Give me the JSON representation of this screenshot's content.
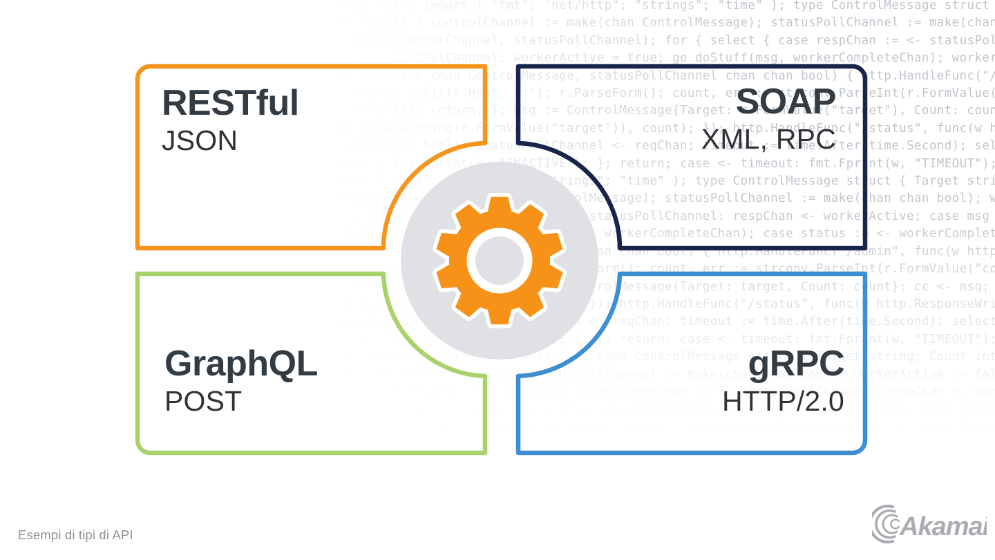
{
  "caption": "Esempi di tipi di API",
  "brand": {
    "logo_name": "akamai-logo",
    "logo_text": "Akamai",
    "logo_color": "#a9acb0"
  },
  "colors": {
    "restful_border": "#F7941E",
    "soap_border": "#17244C",
    "graphql_border": "#A9D26B",
    "grpc_border": "#3D8FD1",
    "gear_orange": "#F79219",
    "hub_disc": "#DFE1E5",
    "title_text": "#333b43",
    "subtitle_text": "#2f3237",
    "caption_text": "#8e9196",
    "code_text": "#9aa3ae",
    "background": "#ffffff"
  },
  "center": {
    "icon_name": "gear-icon",
    "teeth": 10
  },
  "quadrants": [
    {
      "id": "restful",
      "title": "RESTful",
      "subtitle": "JSON",
      "border_color": "#F7941E",
      "position": "top-left"
    },
    {
      "id": "soap",
      "title": "SOAP",
      "subtitle": "XML, RPC",
      "border_color": "#17244C",
      "position": "top-right"
    },
    {
      "id": "graphql",
      "title": "GraphQL",
      "subtitle": "POST",
      "border_color": "#A9D26B",
      "position": "bottom-left"
    },
    {
      "id": "grpc",
      "title": "gRPC",
      "subtitle": "HTTP/2.0",
      "border_color": "#3D8FD1",
      "position": "bottom-right"
    }
  ],
  "background_code": "ackage main; import ( \"fmt\"; \"net/http\"; \"strings\"; \"time\" ); type ControlMessage struct { Target string; Count int64; };\nfunc main() { controlChannel := make(chan ControlMessage); statusPollChannel := make(chan chan bool); workerActive := false;\ngo admin(controlChannel, statusPollChannel); for { select { case respChan := <- statusPollChannel: respChan <- workerActive; case\nmsg := <-controlChannel: workerActive = true; go doStuff(msg, workerCompleteChan); workerActive = status;\nfunc admin(cc chan ControlMessage, statusPollChannel chan chan bool) { http.HandleFunc(\"/admin\", func(w http.ResponseWriter, r *http.Request) { hostTokens\n:= strings.Split(r.Host, \":\"); r.ParseForm(); count, err := strconv.ParseInt(r.FormValue(\"count\"), 10, 64); if err != nil { fmt.Fprintf(w,\nerr.Error()); return; }; msg := ControlMessage{Target: r.FormValue(\"target\"), Count: count}; cc <- msg; fmt.Fprintf(w, \"Control message issued for Target %s, count %d\",\nhtml.EscapeString(r.FormValue(\"target\")), count); }); http.HandleFunc(\"/status\", func(w http.ResponseWriter, r *http.Request) { reqChan\n:= make(chan bool); statusPollChannel <- reqChan; timeout := time.After(time.Second); select { case result := <- reqChan: if result { fmt.Fprint(w, \"ACTIVE\");\n} else { fmt.Fprint(w, \"INACTIVE\"); }; return; case <- timeout: fmt.Fprint(w, \"TIMEOUT\"); }; }); log.Fatal(http.ListenAndServe(\":1337\", nil)); };package main;\nimport ( \"fmt\"; \"net/http\"; \"strings\"; \"time\" ); type ControlMessage struct { Target string; Count int64; }; func main() {\ncontrolChannel := make(chan ControlMessage); statusPollChannel := make(chan chan bool); workerActive := false; go admin(cc, spc);\nfor { select { case respChan := <- statusPollChannel: respChan <- workerActive; case msg := <-controlChannel:\nworkerActive = true; go doStuff(msg, workerCompleteChan); case status := <- workerCompleteChan: workerActive = status; }}); func admin(cc chan\nControlMessage, statusPollChannel chan chan bool) { http.HandleFunc(\"/admin\", func(w http.ResponseWriter, r *http.Request) { hostTokens :=\nstrings.Split(r.Host, \":\"); r.ParseForm(); count, err := strconv.ParseInt(r.FormValue(\"count\"), 10, 64); if err != nil { fmt.Fprintf(w,\nerr.Error()); return; }; msg := ControlMessage{Target: target, Count: count}; cc <- msg; fmt.Fprintf(w, \"Control message issued for Target %s\",\nhtml.EscapeString(target), count); }); http.HandleFunc(\"/status\", func(w http.ResponseWriter, r *http.Request) { reqChan :=\nmake(chan bool); statusPollChannel <- reqChan; timeout := time.After(time.Second); select { case result := <- reqChan: if result { fmt.Fprint(w, \"ACTIVE\");\n} else { fmt.Fprint(w, \"INACTIVE\"); }; return; case <- timeout: fmt.Fprint(w, \"TIMEOUT\"); }; }); log.Fatal(http.ListenAndServe(\":1337\", nil)); };package\nmain; import ( \"fmt\"; \"net/http\" ); type ControlMessage struct { Target string; Count int64; }; func main() { controlChannel :=\nmake(chan ControlMessage); statusPollChannel := make(chan chan bool); workerActive := false; go admin(controlChannel,\nstatusPollChannel); for { select { case respChan := <- statusPollChannel: respChan <- workerActive; case msg := <-\ncontrolChannel: workerActive = true; go doStuff(msg, workerCompleteChan); }}); func admin(cc chan ControlMessage,\nspc chan chan bool) { http.HandleFunc(\"/admin\", func(w http.ResponseWriter, r *http.Request) { hostTokens := strings.Split(r.Host);\nr.ParseForm(); count, err := strconv.ParseInt(r.FormValue(\"count\")); if err != nil { fmt.Fprintf(w, err.Error()); return; };\nmsg := ControlMessage{Target: target, Count: count}; cc <- msg; fmt.Fprintf(w, \"Control message issued for Target\");\nhtml.EscapeString(target); }); http.HandleFunc(\"/status\", func(w http.ResponseWriter, r *http.Request) { reqChan := make(chan bool);\nstatusPollChannel <- reqChan; timeout := time.After(time.Second); select { case result := <- reqChan: fmt.Fprint(w, \"ACTIVE\");\ncase <- timeout: fmt.Fprint(w, \"TIMEOUT\"); }; }); log.Fatal(http.ListenAndServe(\":1337\", nil)); };package main; import ( \"fmt\" );"
}
